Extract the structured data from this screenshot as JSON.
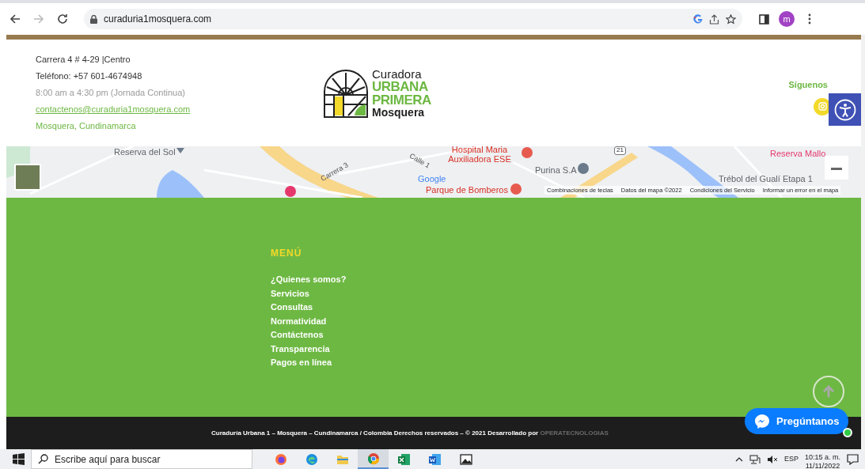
{
  "browser": {
    "url": "curaduria1mosquera.com",
    "avatar": "m",
    "back_disabled": false,
    "forward_disabled": true
  },
  "header": {
    "contact": [
      {
        "text": "Carrera 4 # 4-29 |Centro",
        "kind": "plain"
      },
      {
        "text": "Teléfono: +57 601-4674948",
        "kind": "plain"
      },
      {
        "text": "8:00 am a 4:30 pm (Jornada Continua)",
        "kind": "muted"
      },
      {
        "text": "contactenos@curaduria1mosquera.com",
        "kind": "link"
      },
      {
        "text": "Mosquera, Cundinamarca",
        "kind": "accent"
      }
    ],
    "logo": {
      "line_1": "Curadora",
      "line_2": "URBANA",
      "line_3": "PRIMERA",
      "line_4": "Mosquera"
    },
    "follow": {
      "title": "Síguenos"
    }
  },
  "map": {
    "labels": [
      {
        "text": "Reserva del Sol",
        "kind": "place"
      },
      {
        "text": "Carrera 3",
        "kind": "road"
      },
      {
        "text": "Calle 1",
        "kind": "road"
      },
      {
        "text": "Hospital Maria Auxiliadora ESE",
        "kind": "health"
      },
      {
        "text": "Parque de Bomberos",
        "kind": "health"
      },
      {
        "text": "Purina S.A",
        "kind": "place"
      },
      {
        "text": "Reserva Mallo",
        "kind": "pink"
      },
      {
        "text": "Trébol del Gualí Etapa 1",
        "kind": "place"
      }
    ],
    "road_shield": "21",
    "brand": "Google",
    "attribution": [
      "Combinaciones de teclas",
      "Datos del mapa ©2022",
      "Condiciones del Servicio",
      "Informar un error en el mapa"
    ]
  },
  "menu": {
    "title": "MENÚ",
    "items": [
      "¿Quienes somos?",
      "Servicios",
      "Consultas",
      "Normatividad",
      "Contáctenos",
      "Transparencia",
      "Pagos en línea"
    ]
  },
  "footer": {
    "text": "Curaduría Urbana 1 – Mosquera – Cundinamarca / Colombia Derechos reservados – © 2021 Desarrollado por",
    "developer": "OPERATECNOLOGIAS"
  },
  "chat": {
    "label": "Pregúntanos",
    "online": true
  },
  "taskbar": {
    "search_placeholder": "Escribe aquí para buscar",
    "apps": [
      {
        "kind": "firefox",
        "selected": false
      },
      {
        "kind": "edge",
        "selected": false
      },
      {
        "kind": "folder",
        "selected": false
      },
      {
        "kind": "chrome",
        "selected": true
      },
      {
        "kind": "excel",
        "selected": false
      },
      {
        "kind": "word",
        "selected": false
      },
      {
        "kind": "photos",
        "selected": false
      }
    ],
    "language": "ESP",
    "time": "10:15 a. m.",
    "date": "11/11/2022"
  }
}
